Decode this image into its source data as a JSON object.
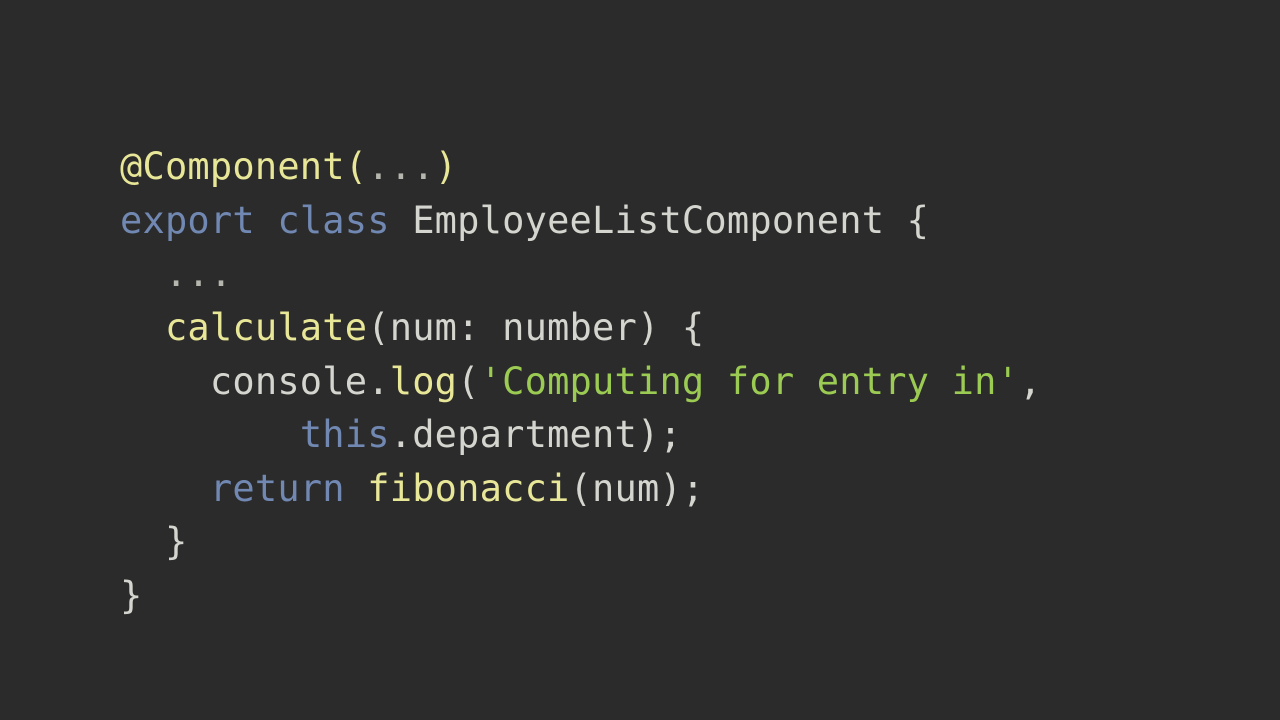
{
  "colors": {
    "background": "#2b2b2b",
    "default": "#d5d5d0",
    "keyword": "#7188b3",
    "method": "#e8e697",
    "string": "#9bcb52",
    "punct": "#cfd0c7",
    "dim": "#b5b6ad"
  },
  "code": [
    [
      {
        "t": "@Component(",
        "c": "method"
      },
      {
        "t": "...",
        "c": "dim"
      },
      {
        "t": ")",
        "c": "method"
      }
    ],
    [
      {
        "t": "export",
        "c": "keyword"
      },
      {
        "t": " ",
        "c": "default"
      },
      {
        "t": "class",
        "c": "keyword"
      },
      {
        "t": " EmployeeListComponent {",
        "c": "default"
      }
    ],
    [
      {
        "t": "  ",
        "c": "default"
      },
      {
        "t": "...",
        "c": "dim"
      }
    ],
    [
      {
        "t": "  ",
        "c": "default"
      },
      {
        "t": "calculate",
        "c": "method"
      },
      {
        "t": "(num: number) {",
        "c": "default"
      }
    ],
    [
      {
        "t": "    console.",
        "c": "default"
      },
      {
        "t": "log",
        "c": "method"
      },
      {
        "t": "(",
        "c": "default"
      },
      {
        "t": "'Computing for entry in'",
        "c": "string"
      },
      {
        "t": ",",
        "c": "default"
      }
    ],
    [
      {
        "t": "        ",
        "c": "default"
      },
      {
        "t": "this",
        "c": "keyword"
      },
      {
        "t": ".department);",
        "c": "default"
      }
    ],
    [
      {
        "t": "    ",
        "c": "default"
      },
      {
        "t": "return",
        "c": "keyword"
      },
      {
        "t": " ",
        "c": "default"
      },
      {
        "t": "fibonacci",
        "c": "method"
      },
      {
        "t": "(num);",
        "c": "default"
      }
    ],
    [
      {
        "t": "  }",
        "c": "default"
      }
    ],
    [
      {
        "t": "}",
        "c": "default"
      }
    ]
  ]
}
